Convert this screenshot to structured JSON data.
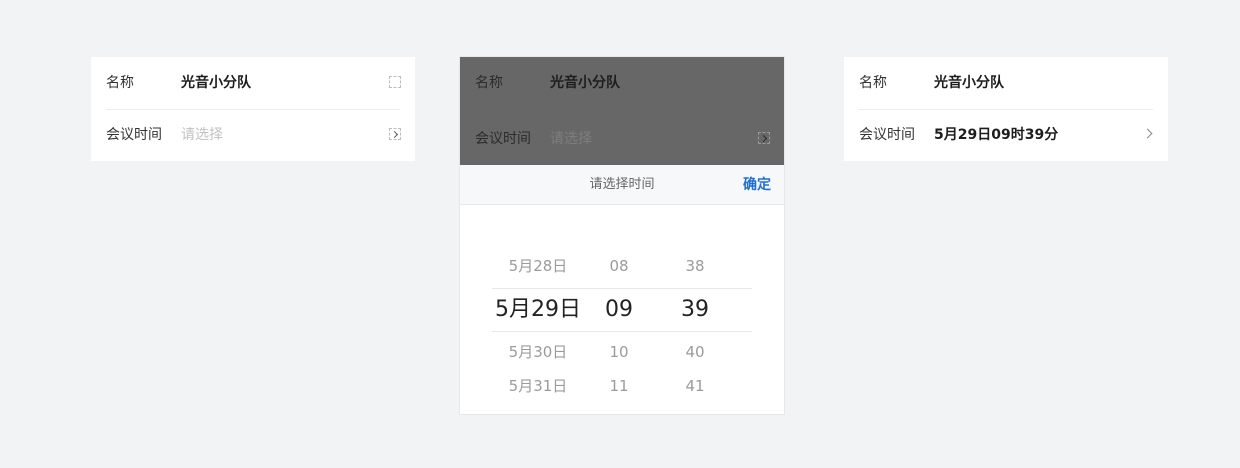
{
  "form": {
    "name_label": "名称",
    "name_value": "光音小分队",
    "time_label": "会议时间",
    "time_placeholder": "请选择",
    "time_selected_value": "5月29日09时39分"
  },
  "picker": {
    "title": "请选择时间",
    "confirm_label": "确定",
    "days": [
      "5月28日",
      "5月29日",
      "5月30日",
      "5月31日"
    ],
    "hours": [
      "08",
      "09",
      "10",
      "11"
    ],
    "minutes": [
      "38",
      "39",
      "40",
      "41"
    ],
    "selected_index": 1
  },
  "colors": {
    "background": "#f2f3f5",
    "accent": "#1f6ed4",
    "overlay": "#676767"
  }
}
